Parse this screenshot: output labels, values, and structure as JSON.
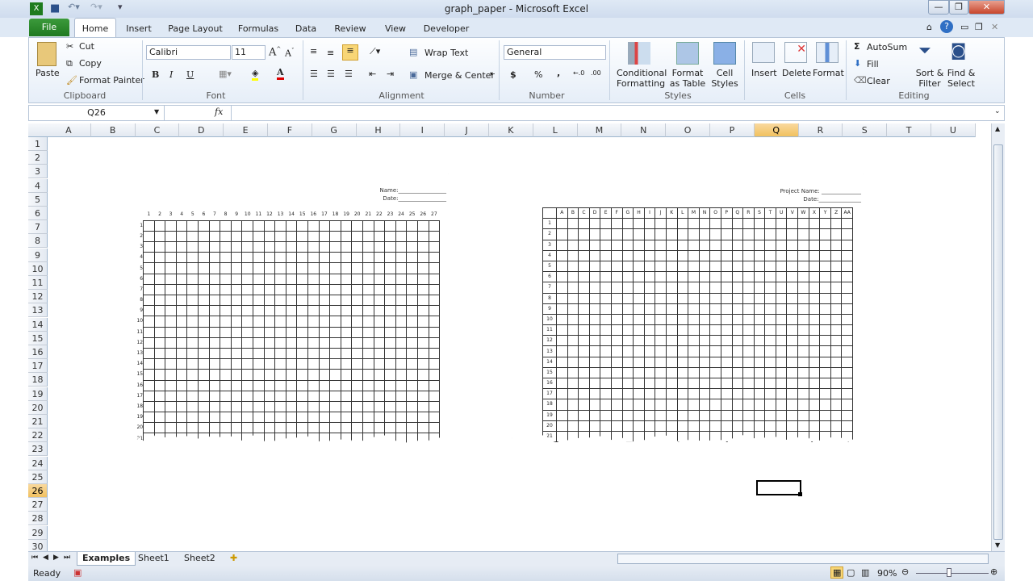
{
  "window": {
    "title": "graph_paper - Microsoft Excel"
  },
  "ribbon_tabs": [
    "File",
    "Home",
    "Insert",
    "Page Layout",
    "Formulas",
    "Data",
    "Review",
    "View",
    "Developer"
  ],
  "clipboard": {
    "paste": "Paste",
    "cut": "Cut",
    "copy": "Copy",
    "format_painter": "Format Painter",
    "label": "Clipboard"
  },
  "font": {
    "name": "Calibri",
    "size": "11",
    "bold": "B",
    "italic": "I",
    "underline": "U",
    "label": "Font"
  },
  "alignment": {
    "wrap": "Wrap Text",
    "merge": "Merge & Center",
    "label": "Alignment"
  },
  "number": {
    "format": "General",
    "currency": "$",
    "percent": "%",
    "comma": ",",
    "label": "Number"
  },
  "styles": {
    "conditional": [
      "Conditional",
      "Formatting"
    ],
    "table": [
      "Format",
      "as Table"
    ],
    "cell": [
      "Cell",
      "Styles"
    ],
    "label": "Styles"
  },
  "cells": {
    "insert": "Insert",
    "delete": "Delete",
    "format": "Format",
    "label": "Cells"
  },
  "editing": {
    "autosum": "AutoSum",
    "fill": "Fill",
    "clear": "Clear",
    "sort": [
      "Sort &",
      "Filter"
    ],
    "find": [
      "Find &",
      "Select"
    ],
    "label": "Editing"
  },
  "formula_bar": {
    "name_box": "Q26",
    "fx": "fx",
    "value": ""
  },
  "columns": [
    "A",
    "B",
    "C",
    "D",
    "E",
    "F",
    "G",
    "H",
    "I",
    "J",
    "K",
    "L",
    "M",
    "N",
    "O",
    "P",
    "Q",
    "R",
    "S",
    "T",
    "U"
  ],
  "selected": {
    "column": "Q",
    "row": 26
  },
  "paper1": {
    "name_label": "Name:_________________",
    "date_label": "Date:_________________",
    "rows": 21,
    "cols": 27
  },
  "paper2": {
    "name_label": "Project Name: ______________",
    "date_label": "Date:_______________",
    "rows": 21,
    "col_labels": [
      "A",
      "B",
      "C",
      "D",
      "E",
      "F",
      "G",
      "H",
      "I",
      "J",
      "K",
      "L",
      "M",
      "N",
      "O",
      "P",
      "Q",
      "R",
      "S",
      "T",
      "U",
      "V",
      "W",
      "X",
      "Y",
      "Z",
      "AA"
    ]
  },
  "sheets": [
    "Examples",
    "Sheet1",
    "Sheet2"
  ],
  "active_sheet": "Examples",
  "status": {
    "text": "Ready",
    "zoom": "90%"
  },
  "colors": {
    "file_tab": "#2a8a2a",
    "selection": "#f1c15f"
  }
}
